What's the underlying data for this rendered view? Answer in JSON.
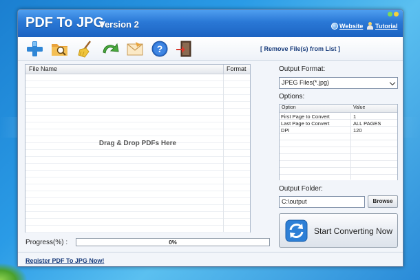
{
  "app": {
    "title": "PDF To JPG",
    "version": "Version 2",
    "links": {
      "website": "Website",
      "tutorial": "Tutorial"
    }
  },
  "toolbar": {
    "buttons": [
      {
        "name": "add-files-button",
        "icon": "plus-icon"
      },
      {
        "name": "add-folder-button",
        "icon": "folder-search-icon"
      },
      {
        "name": "clear-list-button",
        "icon": "broom-icon"
      },
      {
        "name": "refresh-button",
        "icon": "green-arrow-icon"
      },
      {
        "name": "email-button",
        "icon": "envelope-icon"
      },
      {
        "name": "help-button",
        "icon": "question-icon"
      },
      {
        "name": "exit-button",
        "icon": "exit-door-icon"
      }
    ],
    "remove_label": "[ Remove File(s) from List ]"
  },
  "file_list": {
    "columns": [
      "File Name",
      "Format"
    ],
    "drop_hint": "Drag & Drop PDFs Here",
    "rows": []
  },
  "progress": {
    "label": "Progress(%)  :",
    "value_text": "0%",
    "value": 0
  },
  "register_label": "Register PDF To JPG Now!",
  "output_format": {
    "label": "Output Format:",
    "selected": "JPEG Files(*.jpg)"
  },
  "options": {
    "label": "Options:",
    "columns": [
      "Option",
      "Value"
    ],
    "rows": [
      {
        "option": "First Page to Convert",
        "value": "1"
      },
      {
        "option": "Last Page to Convert",
        "value": "ALL PAGES"
      },
      {
        "option": "DPI",
        "value": "120"
      }
    ]
  },
  "output_folder": {
    "label": "Output Folder:",
    "value": "C:\\output",
    "browse_label": "Browse"
  },
  "convert_label": "Start Converting Now",
  "colors": {
    "titlebar": "#2a78d6",
    "accent_link": "#1a3d7c",
    "progress_fill": "#53b94a"
  }
}
